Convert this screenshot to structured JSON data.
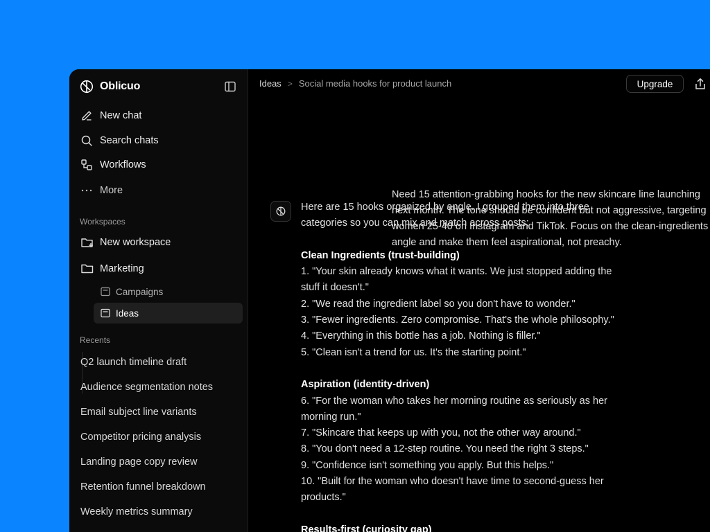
{
  "app": {
    "name": "Oblicuo"
  },
  "sidebar": {
    "nav": [
      {
        "label": "New chat",
        "icon": "pencil-icon"
      },
      {
        "label": "Search chats",
        "icon": "search-icon"
      },
      {
        "label": "Workflows",
        "icon": "workflow-icon"
      },
      {
        "label": "More",
        "icon": "ellipsis-icon"
      }
    ],
    "workspaces_label": "Workspaces",
    "workspaces": [
      {
        "label": "New workspace",
        "icon": "folder-plus-icon"
      },
      {
        "label": "Marketing",
        "icon": "folder-icon"
      }
    ],
    "sub_items": [
      {
        "label": "Campaigns",
        "icon": "doc-icon",
        "active": false
      },
      {
        "label": "Ideas",
        "icon": "doc-icon",
        "active": true
      }
    ],
    "recents_label": "Recents",
    "recents": [
      "Q2 launch timeline draft",
      "Audience segmentation notes",
      "Email subject line variants",
      "Competitor pricing analysis",
      "Landing page copy review",
      "Retention funnel breakdown",
      "Weekly metrics summary"
    ]
  },
  "topbar": {
    "breadcrumb_root": "Ideas",
    "breadcrumb_sep": ">",
    "breadcrumb_current": "Social media hooks for product launch",
    "upgrade_label": "Upgrade"
  },
  "conversation": {
    "user_message_lines": [
      "Need 15 attention-grabbing hooks for the new skincare line launching",
      "next month. The tone should be confident but not aggressive, targeting",
      "women 25-40 on Instagram and TikTok. Focus on the clean-ingredients",
      "angle and make them feel aspirational, not preachy."
    ],
    "assistant_lines": [
      {
        "text": "Here are 15 hooks organized by angle. I grouped them into three",
        "kind": "line"
      },
      {
        "text": "categories so you can mix and match across posts:",
        "kind": "line"
      },
      {
        "text": "",
        "kind": "gap"
      },
      {
        "text": "Clean Ingredients (trust-building)",
        "kind": "heading"
      },
      {
        "text": "1. \"Your skin already knows what it wants. We just stopped adding the",
        "kind": "line"
      },
      {
        "text": "stuff it doesn't.\"",
        "kind": "line"
      },
      {
        "text": "2. \"We read the ingredient label so you don't have to wonder.\"",
        "kind": "line"
      },
      {
        "text": "3. \"Fewer ingredients. Zero compromise. That's the whole philosophy.\"",
        "kind": "line"
      },
      {
        "text": "4. \"Everything in this bottle has a job. Nothing is filler.\"",
        "kind": "line"
      },
      {
        "text": "5. \"Clean isn't a trend for us. It's the starting point.\"",
        "kind": "line"
      },
      {
        "text": "",
        "kind": "gap"
      },
      {
        "text": "Aspiration (identity-driven)",
        "kind": "heading"
      },
      {
        "text": "6. \"For the woman who takes her morning routine as seriously as her",
        "kind": "line"
      },
      {
        "text": "morning run.\"",
        "kind": "line"
      },
      {
        "text": "7. \"Skincare that keeps up with you, not the other way around.\"",
        "kind": "line"
      },
      {
        "text": "8. \"You don't need a 12-step routine. You need the right 3 steps.\"",
        "kind": "line"
      },
      {
        "text": "9. \"Confidence isn't something you apply. But this helps.\"",
        "kind": "line"
      },
      {
        "text": "10. \"Built for the woman who doesn't have time to second-guess her",
        "kind": "line"
      },
      {
        "text": "products.\"",
        "kind": "line"
      },
      {
        "text": "",
        "kind": "gap"
      },
      {
        "text": "Results-first (curiosity gap)",
        "kind": "heading"
      }
    ]
  },
  "colors": {
    "background": "#0a84ff",
    "window": "#000000",
    "sidebar": "#0b0b0b",
    "active_item": "#1f1f1f"
  }
}
